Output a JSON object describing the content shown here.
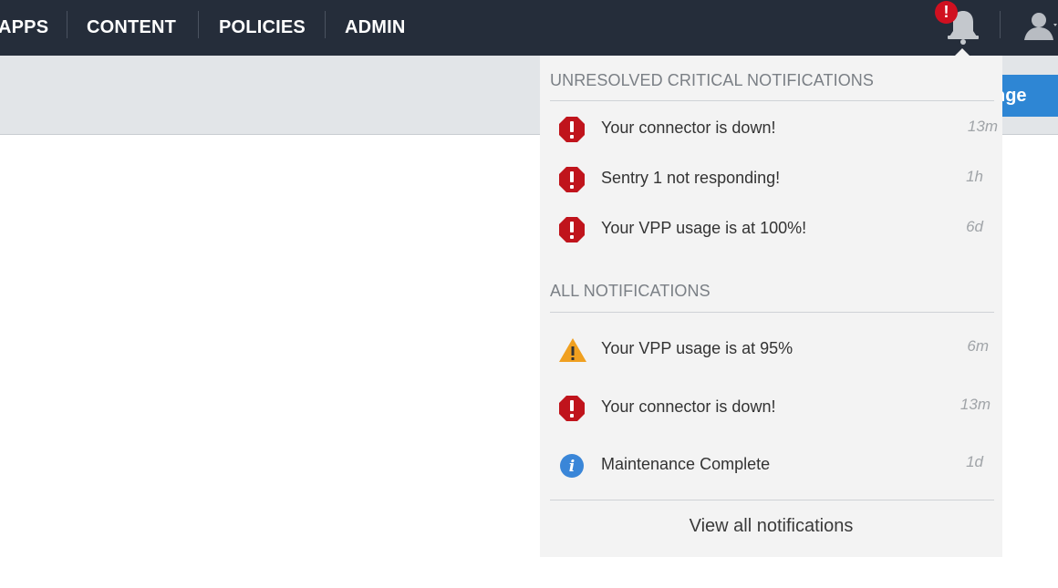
{
  "nav": {
    "items": [
      {
        "label": "APPS"
      },
      {
        "label": "CONTENT"
      },
      {
        "label": "POLICIES"
      },
      {
        "label": "ADMIN"
      }
    ],
    "bell_badge": "!"
  },
  "subbar": {
    "button_label": "nge"
  },
  "dropdown": {
    "critical_title": "UNRESOLVED CRITICAL NOTIFICATIONS",
    "critical": [
      {
        "icon": "critical-stop-icon",
        "text": "Your connector is down!",
        "time": "13m"
      },
      {
        "icon": "critical-stop-icon",
        "text": "Sentry 1 not responding!",
        "time": "1h"
      },
      {
        "icon": "critical-stop-icon",
        "text": "Your VPP usage is at 100%!",
        "time": "6d"
      }
    ],
    "all_title": "ALL NOTIFICATIONS",
    "all": [
      {
        "icon": "warning-triangle-icon",
        "text": "Your VPP usage is at 95%",
        "time": "6m"
      },
      {
        "icon": "critical-stop-icon",
        "text": "Your connector is down!",
        "time": "13m"
      },
      {
        "icon": "info-circle-icon",
        "text": "Maintenance Complete",
        "time": "1d"
      }
    ],
    "view_all": "View all notifications"
  },
  "colors": {
    "topbar": "#252d3a",
    "critical": "#c0141c",
    "warning": "#f0a020",
    "info": "#3a86d8",
    "accent_button": "#2e86d4"
  }
}
